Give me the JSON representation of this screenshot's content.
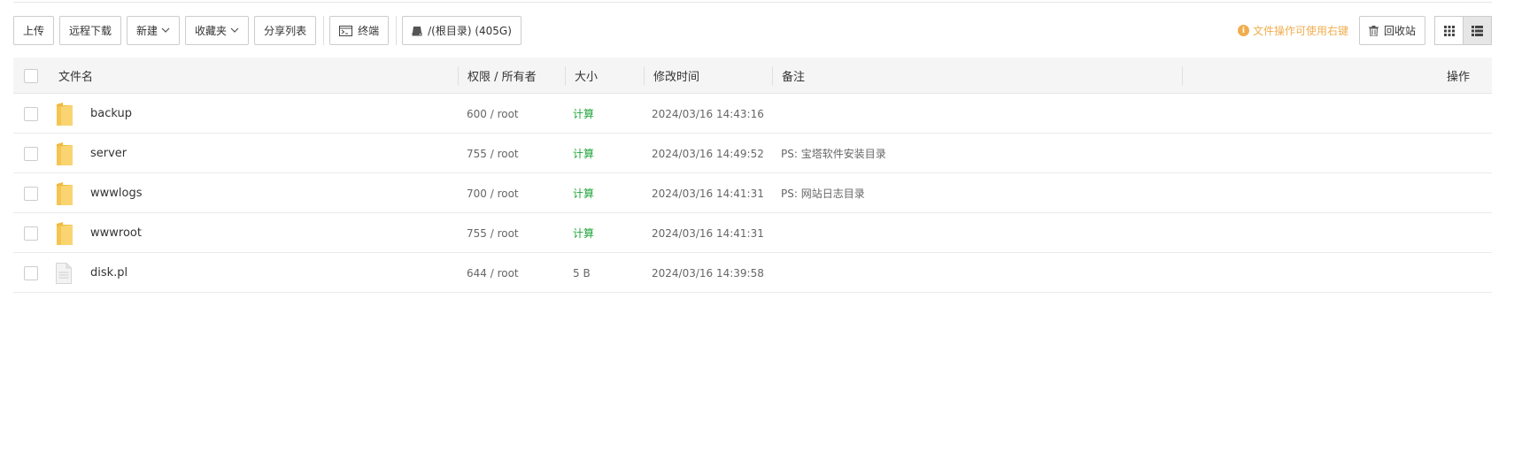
{
  "toolbar": {
    "upload": "上传",
    "remote_download": "远程下载",
    "new": "新建",
    "favorites": "收藏夹",
    "share_list": "分享列表",
    "terminal": "终端",
    "path": "/(根目录) (405G)"
  },
  "right": {
    "hint": "文件操作可使用右键",
    "recycle": "回收站"
  },
  "table": {
    "headers": {
      "name": "文件名",
      "perm": "权限 / 所有者",
      "size": "大小",
      "mtime": "修改时间",
      "note": "备注",
      "ops": "操作"
    },
    "rows": [
      {
        "name": "backup",
        "type": "folder",
        "perm": "600 / root",
        "size": "计算",
        "mtime": "2024/03/16 14:43:16",
        "note": ""
      },
      {
        "name": "server",
        "type": "folder",
        "perm": "755 / root",
        "size": "计算",
        "mtime": "2024/03/16 14:49:52",
        "note": "PS: 宝塔软件安装目录"
      },
      {
        "name": "wwwlogs",
        "type": "folder",
        "perm": "700 / root",
        "size": "计算",
        "mtime": "2024/03/16 14:41:31",
        "note": "PS: 网站日志目录"
      },
      {
        "name": "wwwroot",
        "type": "folder",
        "perm": "755 / root",
        "size": "计算",
        "mtime": "2024/03/16 14:41:31",
        "note": ""
      },
      {
        "name": "disk.pl",
        "type": "file",
        "perm": "644 / root",
        "size": "5 B",
        "mtime": "2024/03/16 14:39:58",
        "note": ""
      }
    ]
  },
  "colors": {
    "accent_green": "#20a53a",
    "hint_orange": "#f0ad4e",
    "folder_yellow": "#f7c948"
  }
}
